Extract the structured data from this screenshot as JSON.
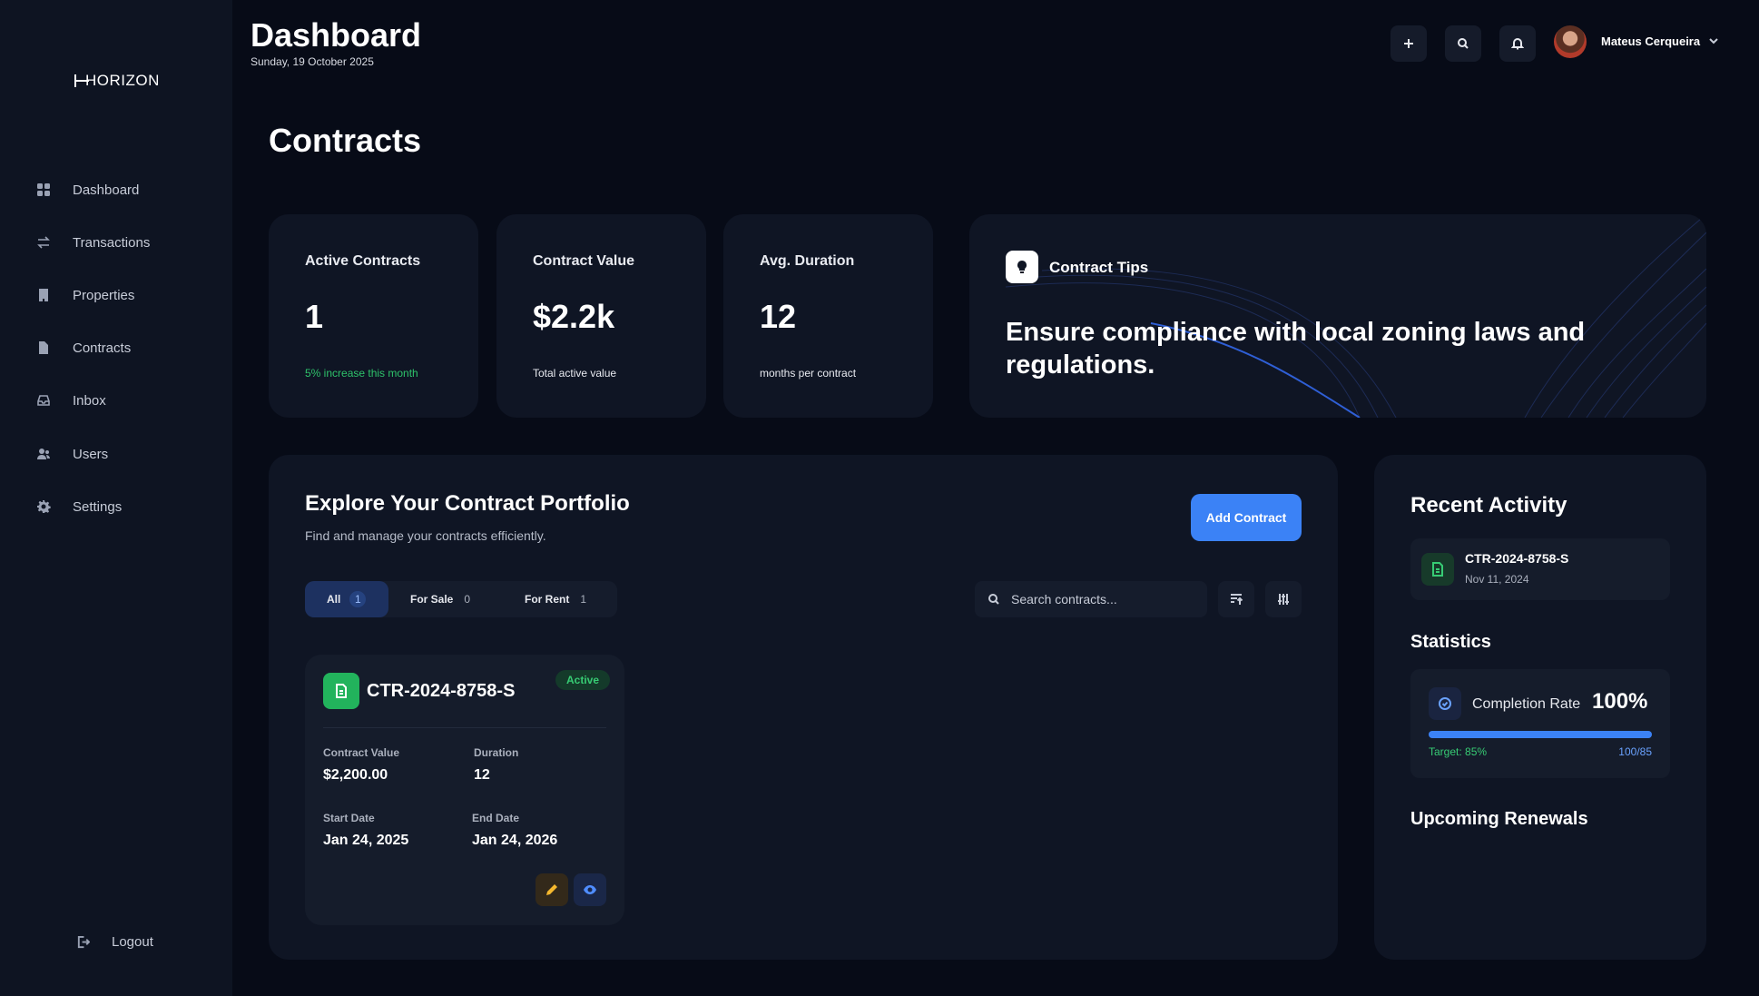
{
  "brand": {
    "logo_text": "HORIZON"
  },
  "sidebar": {
    "items": [
      {
        "label": "Dashboard",
        "icon": "grid-icon"
      },
      {
        "label": "Transactions",
        "icon": "arrows-icon"
      },
      {
        "label": "Properties",
        "icon": "building-icon"
      },
      {
        "label": "Contracts",
        "icon": "document-icon"
      },
      {
        "label": "Inbox",
        "icon": "inbox-icon"
      },
      {
        "label": "Users",
        "icon": "users-icon"
      },
      {
        "label": "Settings",
        "icon": "gear-icon"
      }
    ],
    "logout_label": "Logout"
  },
  "header": {
    "title": "Dashboard",
    "date": "Sunday, 19 October 2025",
    "user_name": "Mateus Cerqueira"
  },
  "page_title": "Contracts",
  "stats": [
    {
      "label": "Active Contracts",
      "value": "1",
      "sub": "5% increase this month",
      "sub_color": "#2ec26a"
    },
    {
      "label": "Contract Value",
      "value": "$2.2k",
      "sub": "Total active value"
    },
    {
      "label": "Avg. Duration",
      "value": "12",
      "sub": "months per contract"
    }
  ],
  "tips": {
    "title": "Contract Tips",
    "text": "Ensure compliance with local zoning laws and regulations."
  },
  "portfolio": {
    "title": "Explore Your Contract Portfolio",
    "subtitle": "Find and manage your contracts efficiently.",
    "add_label": "Add Contract",
    "tabs": [
      {
        "label": "All",
        "count": "1",
        "active": true
      },
      {
        "label": "For Sale",
        "count": "0"
      },
      {
        "label": "For Rent",
        "count": "1"
      }
    ],
    "search_placeholder": "Search contracts..."
  },
  "contract": {
    "id": "CTR-2024-8758-S",
    "status": "Active",
    "value_label": "Contract Value",
    "value": "$2,200.00",
    "duration_label": "Duration",
    "duration": "12",
    "start_label": "Start Date",
    "start": "Jan 24, 2025",
    "end_label": "End Date",
    "end": "Jan 24, 2026"
  },
  "activity": {
    "title": "Recent Activity",
    "item_id": "CTR-2024-8758-S",
    "item_date": "Nov 11, 2024"
  },
  "statistics": {
    "title": "Statistics",
    "label": "Completion Rate",
    "value": "100%",
    "progress": 1.0,
    "target": "Target: 85%",
    "ratio": "100/85"
  },
  "renewals": {
    "title": "Upcoming Renewals"
  },
  "colors": {
    "accent": "#3b82f6",
    "success": "#37cc74",
    "background": "#070b17",
    "panel": "#0f1524"
  }
}
